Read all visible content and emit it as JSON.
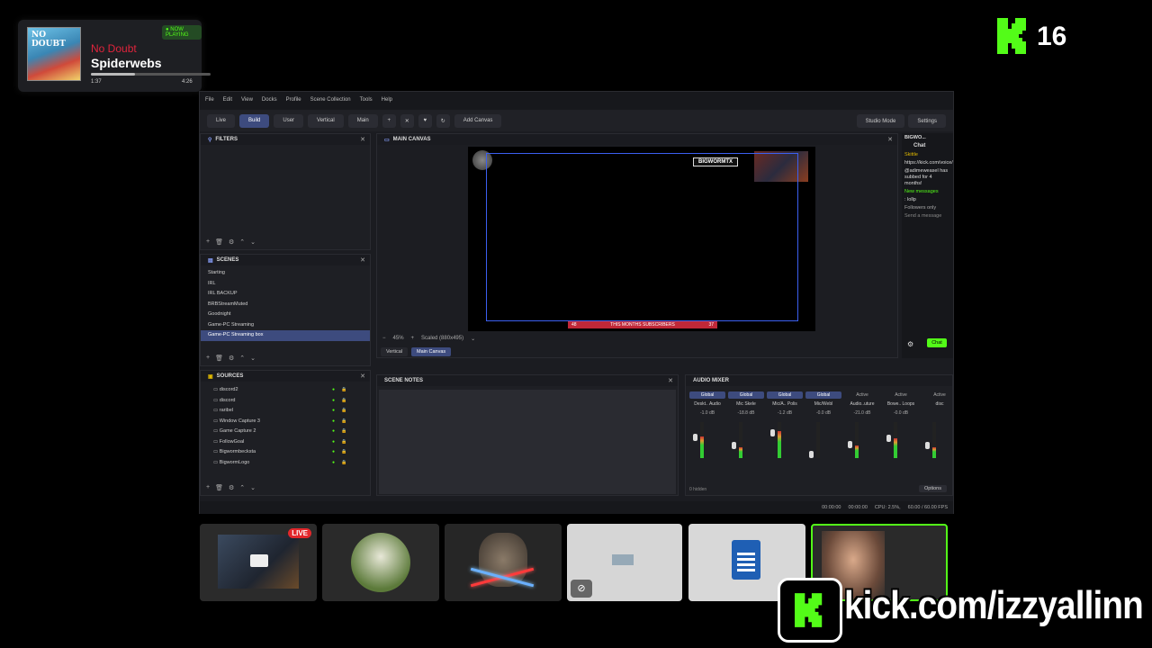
{
  "now_playing": {
    "badge": "● NOW PLAYING",
    "artist": "No Doubt",
    "song": "Spiderwebs",
    "elapsed": "1:37",
    "duration": "4:26",
    "progress": 0.37,
    "art_title": "NO DOUBT"
  },
  "kick_counter": {
    "count": "16"
  },
  "obs": {
    "menu": [
      "File",
      "Edit",
      "View",
      "Docks",
      "Profile",
      "Scene Collection",
      "Tools",
      "Help"
    ],
    "toolbar": {
      "live": "Live",
      "build": "Build",
      "user": "User",
      "vertical": "Vertical",
      "main": "Main",
      "plus": "+",
      "add_canvas": "Add Canvas",
      "studio_mode": "Studio Mode",
      "settings": "Settings"
    },
    "filters": {
      "title": "FILTERS"
    },
    "scenes": {
      "title": "SCENES",
      "items": [
        "Starting",
        "IRL",
        "IRL BACKUP",
        "BRBStreamMuted",
        "Goodnight",
        "Game-PC Streaming",
        "Game-PC Streaming box"
      ],
      "selected_index": 6
    },
    "sources": {
      "title": "SOURCES",
      "items": [
        "discord2",
        "discord",
        "raribel",
        "Window Capture 3",
        "Game Capture 2",
        "FollowGoal",
        "Bigwormbecksta",
        "BigwormLogo"
      ]
    },
    "canvas": {
      "title": "MAIN CANVAS",
      "zoom": "45%",
      "scaled": "Scaled (880x495)",
      "subs_label": "THIS MONTHS SUBSCRIBERS",
      "subs_left": "48",
      "subs_right": "37",
      "logo_text": "BIGWORMTX",
      "tab_vertical": "Vertical",
      "tab_main": "Main Canvas"
    },
    "chat": {
      "title": "BIGWO...",
      "header": "Chat",
      "lines": [
        {
          "text": "Skittle",
          "color": "#e0b800"
        },
        {
          "text": "https://kick.com/voice/bigwormtx",
          "color": "#ddd"
        },
        {
          "text": "@adimeweasel has subbed for 4 months!",
          "color": "#ddd"
        },
        {
          "text": "New messages",
          "color": "#53fc18"
        },
        {
          "text": ": lollp",
          "color": "#ddd"
        },
        {
          "text": "Followers only",
          "color": "#aaa"
        },
        {
          "text": "Send a message",
          "color": "#888"
        }
      ],
      "send": "Chat"
    },
    "notes": {
      "title": "SCENE NOTES"
    },
    "mixer": {
      "title": "AUDIO MIXER",
      "channels": [
        {
          "label": "Global",
          "name": "Deskt.. Audio",
          "db": "-1.0 dB",
          "level": 0.6
        },
        {
          "label": "Global",
          "name": "Mic Skele",
          "db": "-18.8 dB",
          "level": 0.3
        },
        {
          "label": "Global",
          "name": "Mic/A.. Polis",
          "db": "-1.2 dB",
          "level": 0.75
        },
        {
          "label": "Global",
          "name": "Mic/Webl",
          "db": "-0.0 dB",
          "level": 0.0
        },
        {
          "label": "Active",
          "name": "Audio..uture",
          "db": "-21.0 dB",
          "level": 0.35
        },
        {
          "label": "Active",
          "name": "Bowe.. Loops",
          "db": "-0.0 dB",
          "level": 0.55
        },
        {
          "label": "Active",
          "name": "disc",
          "db": "",
          "level": 0.3
        }
      ],
      "no_effects": "0 hidden",
      "options": "Options"
    },
    "status": {
      "time1": "00:00:00",
      "time2": "00:00:00",
      "cpu": "CPU: 2.5%,",
      "fps": "60.00 / 60.00 FPS"
    }
  },
  "tiles": {
    "live_badge": "LIVE"
  },
  "kick_bottom": {
    "url": "kick.com/izzyallinn"
  },
  "colors": {
    "kick_green": "#53fc18",
    "accent": "#3d4b7e",
    "artist_red": "#e0243c"
  }
}
